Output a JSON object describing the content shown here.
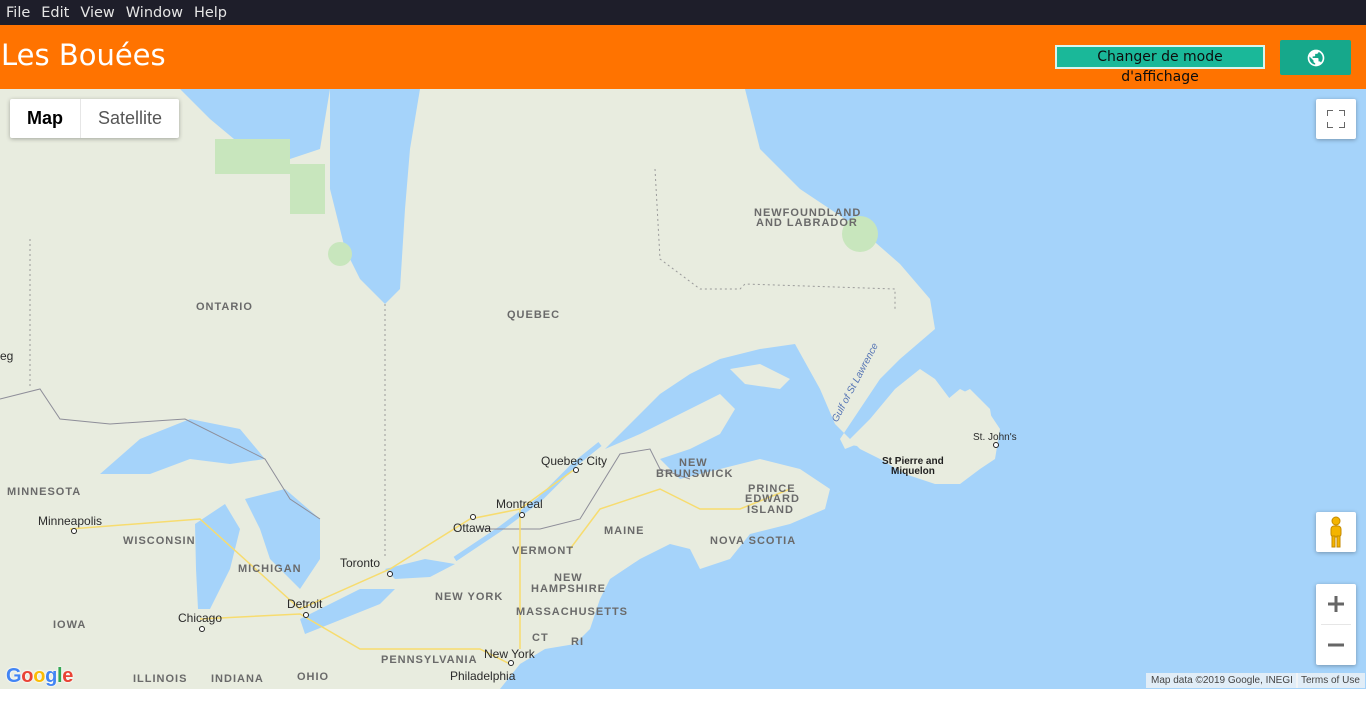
{
  "menubar": {
    "items": [
      "File",
      "Edit",
      "View",
      "Window",
      "Help"
    ]
  },
  "header": {
    "title": "Les Bouées",
    "mode_button_label": "Changer de mode d'affichage",
    "globe_icon": "globe-icon",
    "bg_color": "#ff7300",
    "accent_color": "#16a88b"
  },
  "map": {
    "map_type": {
      "map_label": "Map",
      "satellite_label": "Satellite",
      "selected": "Map"
    },
    "labels": {
      "ontario": "ONTARIO",
      "quebec": "QUEBEC",
      "nl1": "NEWFOUNDLAND",
      "nl2": "AND LABRADOR",
      "minnesota": "MINNESOTA",
      "wisconsin": "WISCONSIN",
      "michigan": "MICHIGAN",
      "iowa": "IOWA",
      "illinois": "ILLINOIS",
      "indiana": "INDIANA",
      "ohio": "OHIO",
      "pennsylvania": "PENNSYLVANIA",
      "newyork_state": "NEW YORK",
      "vermont": "VERMONT",
      "maine": "MAINE",
      "nh1": "NEW",
      "nh2": "HAMPSHIRE",
      "massachusetts": "MASSACHUSETTS",
      "ct": "CT",
      "ri": "RI",
      "nb1": "NEW",
      "nb2": "BRUNSWICK",
      "pei1": "PRINCE",
      "pei2": "EDWARD",
      "pei3": "ISLAND",
      "novascotia": "NOVA SCOTIA",
      "gulf": "Gulf of St Lawrence",
      "winnipeg_partial": "eg",
      "minneapolis": "Minneapolis",
      "chicago": "Chicago",
      "detroit": "Detroit",
      "toronto": "Toronto",
      "ottawa": "Ottawa",
      "montreal": "Montreal",
      "quebec_city": "Quebec City",
      "newyork_city": "New York",
      "philadelphia": "Philadelphia",
      "stjohns": "St. John's",
      "spm1": "St Pierre and",
      "spm2": "Miquelon"
    },
    "controls": {
      "fullscreen_icon": "fullscreen-icon",
      "pegman_icon": "pegman-icon",
      "zoom_in_icon": "plus-icon",
      "zoom_out_icon": "minus-icon"
    },
    "google_logo": {
      "letters": [
        "G",
        "o",
        "o",
        "g",
        "l",
        "e"
      ],
      "colors": [
        "#4285f4",
        "#ea4335",
        "#fbbc05",
        "#4285f4",
        "#34a853",
        "#ea4335"
      ]
    },
    "attribution": {
      "map_data": "Map data ©2019 Google, INEGI",
      "terms": "Terms of Use"
    },
    "colors": {
      "water": "#a5d3fa",
      "land": "#e8ecdf",
      "park": "#c8e6bd",
      "road": "#f7dc6f"
    }
  }
}
